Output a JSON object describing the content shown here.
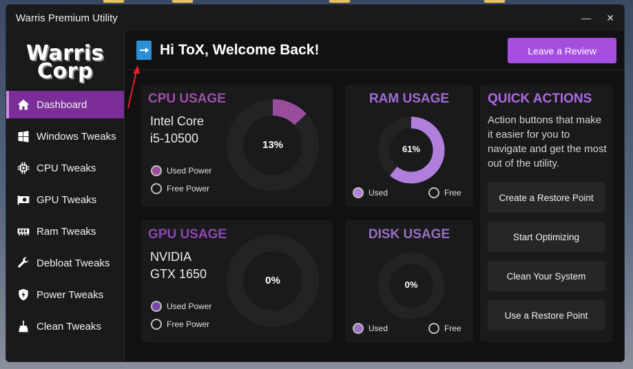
{
  "window": {
    "title": "Warris Premium Utility",
    "minimize_glyph": "—",
    "close_glyph": "✕"
  },
  "logo": {
    "line1": "Warris",
    "line2": "Corp"
  },
  "sidebar": {
    "items": [
      {
        "label": "Dashboard",
        "icon": "home-icon",
        "active": true
      },
      {
        "label": "Windows Tweaks",
        "icon": "windows-icon"
      },
      {
        "label": "CPU Tweaks",
        "icon": "cpu-icon"
      },
      {
        "label": "GPU Tweaks",
        "icon": "gpu-icon"
      },
      {
        "label": "Ram Tweaks",
        "icon": "ram-icon"
      },
      {
        "label": "Debloat Tweaks",
        "icon": "wrench-icon"
      },
      {
        "label": "Power Tweaks",
        "icon": "shield-icon"
      },
      {
        "label": "Clean Tweaks",
        "icon": "broom-icon"
      }
    ]
  },
  "header": {
    "welcome": "Hi ToX, Welcome Back!",
    "review_button": "Leave a Review"
  },
  "cpu": {
    "title": "CPU USAGE",
    "model_line1": "Intel Core",
    "model_line2": "i5-10500",
    "percent_label": "13%",
    "percent": 13,
    "legend_used": "Used Power",
    "legend_free": "Free Power"
  },
  "ram": {
    "title": "RAM USAGE",
    "percent_label": "61%",
    "percent": 61,
    "legend_used": "Used",
    "legend_free": "Free"
  },
  "gpu": {
    "title": "GPU USAGE",
    "model_line1": "NVIDIA",
    "model_line2": "GTX 1650",
    "percent_label": "0%",
    "percent": 0,
    "legend_used": "Used Power",
    "legend_free": "Free Power"
  },
  "disk": {
    "title": "DISK USAGE",
    "percent_label": "0%",
    "percent": 0,
    "legend_used": "Used",
    "legend_free": "Free"
  },
  "quick_actions": {
    "title": "QUICK ACTIONS",
    "description": "Action buttons that make it easier for you to navigate and get the most out of the utility.",
    "buttons": [
      "Create a Restore Point",
      "Start Optimizing",
      "Clean Your System",
      "Use a Restore Point"
    ]
  },
  "colors": {
    "accent": "#a54ee0",
    "cpu_title": "#9e4fa8",
    "cpu_ring": "#9a4d9c",
    "ram_title": "#a36bd6",
    "ram_ring": "#b07fdc",
    "gpu_title": "#8a48b0",
    "disk_title": "#9b6fc4",
    "ring_track": "#232326"
  }
}
